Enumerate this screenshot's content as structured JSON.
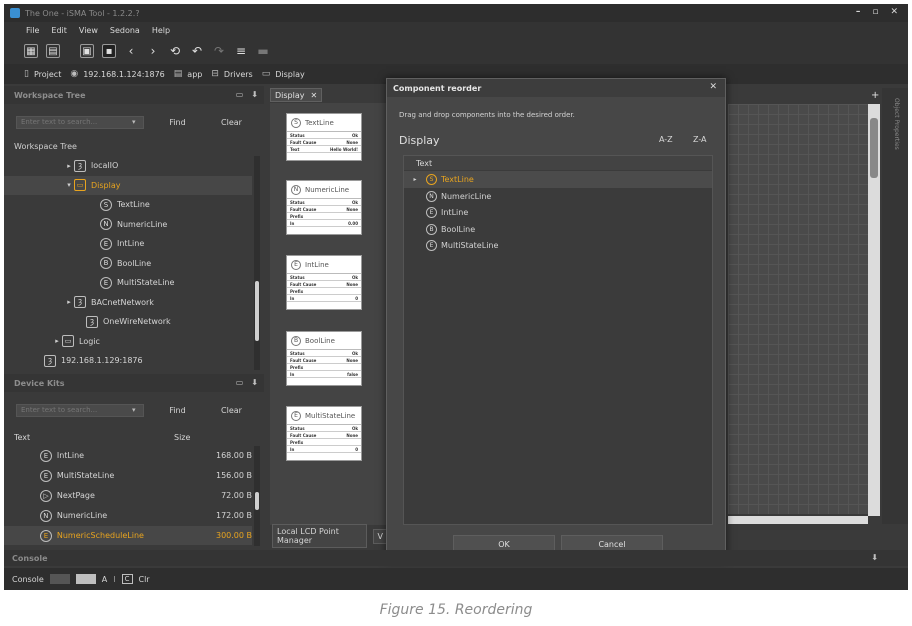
{
  "window": {
    "title": "The One - iSMA Tool - 1.2.2.?"
  },
  "menu": [
    "File",
    "Edit",
    "View",
    "Sedona",
    "Help"
  ],
  "breadcrumb": [
    {
      "icon": "document-icon",
      "label": "Project"
    },
    {
      "icon": "globe-icon",
      "label": "192.168.1.124:1876"
    },
    {
      "icon": "app-icon",
      "label": "app"
    },
    {
      "icon": "folder-icon",
      "label": "Drivers"
    },
    {
      "icon": "display-icon",
      "label": "Display"
    }
  ],
  "workspace": {
    "panel_title": "Workspace Tree",
    "search_placeholder": "Enter text to search...",
    "find_label": "Find",
    "clear_label": "Clear",
    "tree_label": "Workspace Tree",
    "items": [
      {
        "label": "localIO",
        "icon": "Ȝ",
        "expander": "▸"
      },
      {
        "label": "Display",
        "icon": "▭",
        "expander": "▾"
      },
      {
        "label": "TextLine",
        "icon": "S",
        "expander": ""
      },
      {
        "label": "NumericLine",
        "icon": "N",
        "expander": ""
      },
      {
        "label": "IntLine",
        "icon": "E",
        "expander": ""
      },
      {
        "label": "BoolLine",
        "icon": "B",
        "expander": ""
      },
      {
        "label": "MultiStateLine",
        "icon": "E",
        "expander": ""
      },
      {
        "label": "BACnetNetwork",
        "icon": "Ȝ",
        "expander": "▸"
      },
      {
        "label": "OneWireNetwork",
        "icon": "Ȝ",
        "expander": ""
      },
      {
        "label": "Logic",
        "icon": "▭",
        "expander": "▸"
      },
      {
        "label": "192.168.1.129:1876",
        "icon": "Ȝ",
        "expander": ""
      }
    ]
  },
  "device_kits": {
    "panel_title": "Device Kits",
    "search_placeholder": "Enter text to search...",
    "find_label": "Find",
    "clear_label": "Clear",
    "col_text": "Text",
    "col_size": "Size",
    "rows": [
      {
        "icon": "E",
        "name": "IntLine",
        "size": "168.00 B"
      },
      {
        "icon": "E",
        "name": "MultiStateLine",
        "size": "156.00 B"
      },
      {
        "icon": "▷",
        "name": "NextPage",
        "size": "72.00 B"
      },
      {
        "icon": "N",
        "name": "NumericLine",
        "size": "172.00 B"
      },
      {
        "icon": "E",
        "name": "NumericScheduleLine",
        "size": "300.00 B"
      }
    ]
  },
  "editor": {
    "tab_label": "Display",
    "cards": [
      {
        "icon": "S",
        "title": "TextLine",
        "rows": [
          [
            "Status",
            "Ok"
          ],
          [
            "Fault Cause",
            "None"
          ],
          [
            "Text",
            "Hello World!"
          ]
        ]
      },
      {
        "icon": "N",
        "title": "NumericLine",
        "rows": [
          [
            "Status",
            "Ok"
          ],
          [
            "Fault Cause",
            "None"
          ],
          [
            "Prefix",
            ""
          ],
          [
            "In",
            "0.00"
          ]
        ]
      },
      {
        "icon": "E",
        "title": "IntLine",
        "rows": [
          [
            "Status",
            "Ok"
          ],
          [
            "Fault Cause",
            "None"
          ],
          [
            "Prefix",
            ""
          ],
          [
            "In",
            "0"
          ]
        ]
      },
      {
        "icon": "B",
        "title": "BoolLine",
        "rows": [
          [
            "Status",
            "Ok"
          ],
          [
            "Fault Cause",
            "None"
          ],
          [
            "Prefix",
            ""
          ],
          [
            "In",
            "false"
          ]
        ]
      },
      {
        "icon": "E",
        "title": "MultiStateLine",
        "rows": [
          [
            "Status",
            "Ok"
          ],
          [
            "Fault Cause",
            "None"
          ],
          [
            "Prefix",
            ""
          ],
          [
            "In",
            "0"
          ]
        ]
      }
    ],
    "bottom_tab_1": "Local LCD Point Manager",
    "bottom_tab_2": "V",
    "side_label": "Object Properties"
  },
  "dialog": {
    "title": "Component reorder",
    "instruction": "Drag and drop components into the desired order.",
    "heading": "Display",
    "sort_az": "A-Z",
    "sort_za": "Z-A",
    "list_header": "Text",
    "items": [
      {
        "icon": "S",
        "label": "TextLine"
      },
      {
        "icon": "N",
        "label": "NumericLine"
      },
      {
        "icon": "E",
        "label": "IntLine"
      },
      {
        "icon": "B",
        "label": "BoolLine"
      },
      {
        "icon": "E",
        "label": "MultiStateLine"
      }
    ],
    "ok_label": "OK",
    "cancel_label": "Cancel"
  },
  "console": {
    "panel_title": "Console",
    "label": "Console",
    "a": "A",
    "sep": "I",
    "icon_c": "C",
    "clear": "Clr"
  },
  "caption": "Figure 15. Reordering",
  "colors": {
    "accent": "#e8a41f",
    "background": "#3a3a3a"
  }
}
